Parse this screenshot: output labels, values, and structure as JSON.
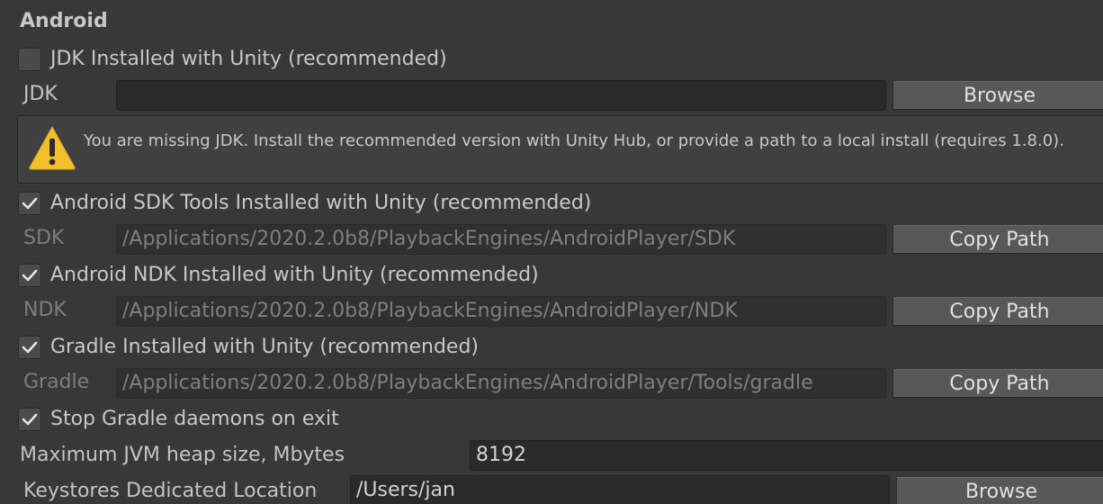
{
  "section": {
    "title": "Android"
  },
  "jdk": {
    "checkbox_label": "JDK Installed with Unity (recommended)",
    "checked": false,
    "field_label": "JDK",
    "path": "",
    "button_label": "Browse",
    "warning": "You are missing JDK. Install the recommended version with Unity Hub, or provide a path to a local install (requires 1.8.0).",
    "warning_icon": "warning-icon"
  },
  "sdk": {
    "checkbox_label": "Android SDK Tools Installed with Unity (recommended)",
    "checked": true,
    "field_label": "SDK",
    "path": "/Applications/2020.2.0b8/PlaybackEngines/AndroidPlayer/SDK",
    "button_label": "Copy Path"
  },
  "ndk": {
    "checkbox_label": "Android NDK Installed with Unity (recommended)",
    "checked": true,
    "field_label": "NDK",
    "path": "/Applications/2020.2.0b8/PlaybackEngines/AndroidPlayer/NDK",
    "button_label": "Copy Path"
  },
  "gradle": {
    "checkbox_label": "Gradle Installed with Unity (recommended)",
    "checked": true,
    "field_label": "Gradle",
    "path": "/Applications/2020.2.0b8/PlaybackEngines/AndroidPlayer/Tools/gradle",
    "button_label": "Copy Path"
  },
  "stop_gradle": {
    "checkbox_label": "Stop Gradle daemons on exit",
    "checked": true
  },
  "jvm_heap": {
    "label": "Maximum JVM heap size, Mbytes",
    "value": "8192"
  },
  "keystores": {
    "label": "Keystores Dedicated Location",
    "value": "/Users/jan",
    "button_label": "Browse"
  },
  "colors": {
    "background": "#383838",
    "field_bg": "#2a2a2a",
    "button_bg": "#585858",
    "warning_yellow": "#f3bf2d"
  }
}
